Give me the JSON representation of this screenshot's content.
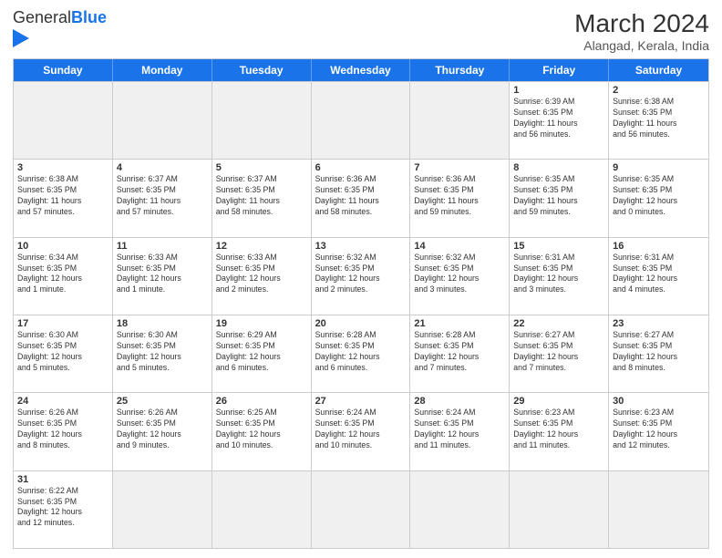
{
  "header": {
    "logo_general": "General",
    "logo_blue": "Blue",
    "title": "March 2024",
    "subtitle": "Alangad, Kerala, India"
  },
  "day_headers": [
    "Sunday",
    "Monday",
    "Tuesday",
    "Wednesday",
    "Thursday",
    "Friday",
    "Saturday"
  ],
  "weeks": [
    {
      "days": [
        {
          "number": "",
          "info": "",
          "empty": true
        },
        {
          "number": "",
          "info": "",
          "empty": true
        },
        {
          "number": "",
          "info": "",
          "empty": true
        },
        {
          "number": "",
          "info": "",
          "empty": true
        },
        {
          "number": "",
          "info": "",
          "empty": true
        },
        {
          "number": "1",
          "info": "Sunrise: 6:39 AM\nSunset: 6:35 PM\nDaylight: 11 hours\nand 56 minutes.",
          "empty": false
        },
        {
          "number": "2",
          "info": "Sunrise: 6:38 AM\nSunset: 6:35 PM\nDaylight: 11 hours\nand 56 minutes.",
          "empty": false
        }
      ]
    },
    {
      "days": [
        {
          "number": "3",
          "info": "Sunrise: 6:38 AM\nSunset: 6:35 PM\nDaylight: 11 hours\nand 57 minutes.",
          "empty": false
        },
        {
          "number": "4",
          "info": "Sunrise: 6:37 AM\nSunset: 6:35 PM\nDaylight: 11 hours\nand 57 minutes.",
          "empty": false
        },
        {
          "number": "5",
          "info": "Sunrise: 6:37 AM\nSunset: 6:35 PM\nDaylight: 11 hours\nand 58 minutes.",
          "empty": false
        },
        {
          "number": "6",
          "info": "Sunrise: 6:36 AM\nSunset: 6:35 PM\nDaylight: 11 hours\nand 58 minutes.",
          "empty": false
        },
        {
          "number": "7",
          "info": "Sunrise: 6:36 AM\nSunset: 6:35 PM\nDaylight: 11 hours\nand 59 minutes.",
          "empty": false
        },
        {
          "number": "8",
          "info": "Sunrise: 6:35 AM\nSunset: 6:35 PM\nDaylight: 11 hours\nand 59 minutes.",
          "empty": false
        },
        {
          "number": "9",
          "info": "Sunrise: 6:35 AM\nSunset: 6:35 PM\nDaylight: 12 hours\nand 0 minutes.",
          "empty": false
        }
      ]
    },
    {
      "days": [
        {
          "number": "10",
          "info": "Sunrise: 6:34 AM\nSunset: 6:35 PM\nDaylight: 12 hours\nand 1 minute.",
          "empty": false
        },
        {
          "number": "11",
          "info": "Sunrise: 6:33 AM\nSunset: 6:35 PM\nDaylight: 12 hours\nand 1 minute.",
          "empty": false
        },
        {
          "number": "12",
          "info": "Sunrise: 6:33 AM\nSunset: 6:35 PM\nDaylight: 12 hours\nand 2 minutes.",
          "empty": false
        },
        {
          "number": "13",
          "info": "Sunrise: 6:32 AM\nSunset: 6:35 PM\nDaylight: 12 hours\nand 2 minutes.",
          "empty": false
        },
        {
          "number": "14",
          "info": "Sunrise: 6:32 AM\nSunset: 6:35 PM\nDaylight: 12 hours\nand 3 minutes.",
          "empty": false
        },
        {
          "number": "15",
          "info": "Sunrise: 6:31 AM\nSunset: 6:35 PM\nDaylight: 12 hours\nand 3 minutes.",
          "empty": false
        },
        {
          "number": "16",
          "info": "Sunrise: 6:31 AM\nSunset: 6:35 PM\nDaylight: 12 hours\nand 4 minutes.",
          "empty": false
        }
      ]
    },
    {
      "days": [
        {
          "number": "17",
          "info": "Sunrise: 6:30 AM\nSunset: 6:35 PM\nDaylight: 12 hours\nand 5 minutes.",
          "empty": false
        },
        {
          "number": "18",
          "info": "Sunrise: 6:30 AM\nSunset: 6:35 PM\nDaylight: 12 hours\nand 5 minutes.",
          "empty": false
        },
        {
          "number": "19",
          "info": "Sunrise: 6:29 AM\nSunset: 6:35 PM\nDaylight: 12 hours\nand 6 minutes.",
          "empty": false
        },
        {
          "number": "20",
          "info": "Sunrise: 6:28 AM\nSunset: 6:35 PM\nDaylight: 12 hours\nand 6 minutes.",
          "empty": false
        },
        {
          "number": "21",
          "info": "Sunrise: 6:28 AM\nSunset: 6:35 PM\nDaylight: 12 hours\nand 7 minutes.",
          "empty": false
        },
        {
          "number": "22",
          "info": "Sunrise: 6:27 AM\nSunset: 6:35 PM\nDaylight: 12 hours\nand 7 minutes.",
          "empty": false
        },
        {
          "number": "23",
          "info": "Sunrise: 6:27 AM\nSunset: 6:35 PM\nDaylight: 12 hours\nand 8 minutes.",
          "empty": false
        }
      ]
    },
    {
      "days": [
        {
          "number": "24",
          "info": "Sunrise: 6:26 AM\nSunset: 6:35 PM\nDaylight: 12 hours\nand 8 minutes.",
          "empty": false
        },
        {
          "number": "25",
          "info": "Sunrise: 6:26 AM\nSunset: 6:35 PM\nDaylight: 12 hours\nand 9 minutes.",
          "empty": false
        },
        {
          "number": "26",
          "info": "Sunrise: 6:25 AM\nSunset: 6:35 PM\nDaylight: 12 hours\nand 10 minutes.",
          "empty": false
        },
        {
          "number": "27",
          "info": "Sunrise: 6:24 AM\nSunset: 6:35 PM\nDaylight: 12 hours\nand 10 minutes.",
          "empty": false
        },
        {
          "number": "28",
          "info": "Sunrise: 6:24 AM\nSunset: 6:35 PM\nDaylight: 12 hours\nand 11 minutes.",
          "empty": false
        },
        {
          "number": "29",
          "info": "Sunrise: 6:23 AM\nSunset: 6:35 PM\nDaylight: 12 hours\nand 11 minutes.",
          "empty": false
        },
        {
          "number": "30",
          "info": "Sunrise: 6:23 AM\nSunset: 6:35 PM\nDaylight: 12 hours\nand 12 minutes.",
          "empty": false
        }
      ]
    },
    {
      "days": [
        {
          "number": "31",
          "info": "Sunrise: 6:22 AM\nSunset: 6:35 PM\nDaylight: 12 hours\nand 12 minutes.",
          "empty": false
        },
        {
          "number": "",
          "info": "",
          "empty": true
        },
        {
          "number": "",
          "info": "",
          "empty": true
        },
        {
          "number": "",
          "info": "",
          "empty": true
        },
        {
          "number": "",
          "info": "",
          "empty": true
        },
        {
          "number": "",
          "info": "",
          "empty": true
        },
        {
          "number": "",
          "info": "",
          "empty": true
        }
      ]
    }
  ]
}
